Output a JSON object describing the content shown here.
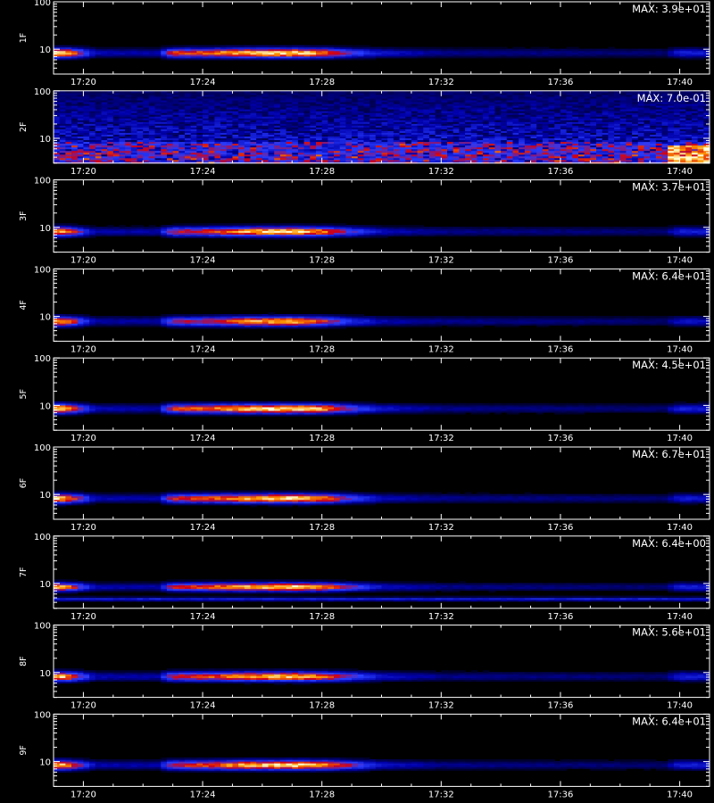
{
  "chart_data": {
    "type": "heatmap",
    "colors": {
      "background": "#000000",
      "axes": "#ffffff",
      "colormap": [
        "#000000",
        "#0000b0",
        "#2030ff",
        "#d00010",
        "#ffa000",
        "#ffffd0"
      ]
    },
    "x_ticks": [
      "17:20",
      "17:24",
      "17:28",
      "17:32",
      "17:36",
      "17:40"
    ],
    "x_range_minutes": [
      "17:19",
      "17:41"
    ],
    "y_scale": "log",
    "y_range": [
      3,
      100
    ],
    "y_ticks": [
      "100",
      "10"
    ],
    "xlabel": "",
    "panels": [
      {
        "ylabel": "1F",
        "max": "MAX: 3.9e+01",
        "band": [
          4.8,
          8.2
        ],
        "peak": 8.5,
        "activity": [
          [
            0,
            1.0
          ],
          [
            0.4,
            0.95
          ],
          [
            1.0,
            0.5
          ],
          [
            1.4,
            0.2
          ],
          [
            3.5,
            0.18
          ],
          [
            4.0,
            0.7
          ],
          [
            5.0,
            0.75
          ],
          [
            6.5,
            0.95
          ],
          [
            8.0,
            1.0
          ],
          [
            9.0,
            0.85
          ],
          [
            10.0,
            0.45
          ],
          [
            11.0,
            0.25
          ],
          [
            13.0,
            0.15
          ],
          [
            20.5,
            0.12
          ],
          [
            21.0,
            0.3
          ],
          [
            22.0,
            0.28
          ]
        ]
      },
      {
        "ylabel": "2F",
        "max": "MAX: 7.0e-01",
        "band": [
          3,
          100
        ],
        "peak": 0.7,
        "noisy": true,
        "activity": [
          [
            0,
            0.6
          ],
          [
            22.0,
            0.6
          ]
        ]
      },
      {
        "ylabel": "3F",
        "max": "MAX: 3.7e+01",
        "band": [
          4.8,
          8.2
        ],
        "peak": 8.3,
        "activity": [
          [
            0,
            0.9
          ],
          [
            0.4,
            0.85
          ],
          [
            1.0,
            0.4
          ],
          [
            1.4,
            0.18
          ],
          [
            3.5,
            0.18
          ],
          [
            4.0,
            0.6
          ],
          [
            5.0,
            0.65
          ],
          [
            6.5,
            0.9
          ],
          [
            8.0,
            1.0
          ],
          [
            9.0,
            0.8
          ],
          [
            10.0,
            0.45
          ],
          [
            11.0,
            0.22
          ],
          [
            13.0,
            0.15
          ],
          [
            20.5,
            0.12
          ],
          [
            21.0,
            0.3
          ],
          [
            22.0,
            0.28
          ]
        ]
      },
      {
        "ylabel": "4F",
        "max": "MAX: 6.4e+01",
        "band": [
          4.8,
          8.2
        ],
        "peak": 8.0,
        "activity": [
          [
            0,
            0.9
          ],
          [
            0.4,
            0.85
          ],
          [
            1.0,
            0.4
          ],
          [
            1.4,
            0.18
          ],
          [
            3.5,
            0.18
          ],
          [
            4.0,
            0.55
          ],
          [
            5.0,
            0.6
          ],
          [
            6.5,
            0.85
          ],
          [
            8.0,
            0.95
          ],
          [
            9.0,
            0.7
          ],
          [
            10.0,
            0.35
          ],
          [
            11.0,
            0.2
          ],
          [
            13.0,
            0.15
          ],
          [
            20.5,
            0.12
          ],
          [
            21.0,
            0.25
          ],
          [
            22.0,
            0.22
          ]
        ]
      },
      {
        "ylabel": "5F",
        "max": "MAX: 4.5e+01",
        "band": [
          4.8,
          8.2
        ],
        "peak": 8.7,
        "activity": [
          [
            0,
            1.0
          ],
          [
            0.4,
            0.95
          ],
          [
            1.0,
            0.45
          ],
          [
            1.4,
            0.2
          ],
          [
            3.5,
            0.18
          ],
          [
            4.0,
            0.7
          ],
          [
            5.0,
            0.75
          ],
          [
            6.5,
            0.95
          ],
          [
            8.0,
            1.0
          ],
          [
            9.0,
            0.9
          ],
          [
            10.0,
            0.5
          ],
          [
            11.0,
            0.25
          ],
          [
            13.0,
            0.15
          ],
          [
            20.5,
            0.12
          ],
          [
            21.0,
            0.3
          ],
          [
            22.0,
            0.28
          ]
        ]
      },
      {
        "ylabel": "6F",
        "max": "MAX: 6.7e+01",
        "band": [
          4.8,
          8.2
        ],
        "peak": 8.4,
        "activity": [
          [
            0,
            0.95
          ],
          [
            0.4,
            0.9
          ],
          [
            1.0,
            0.45
          ],
          [
            1.4,
            0.2
          ],
          [
            3.5,
            0.18
          ],
          [
            4.0,
            0.65
          ],
          [
            5.0,
            0.7
          ],
          [
            6.5,
            0.9
          ],
          [
            8.0,
            1.0
          ],
          [
            9.0,
            0.85
          ],
          [
            10.0,
            0.45
          ],
          [
            11.0,
            0.22
          ],
          [
            13.0,
            0.15
          ],
          [
            20.5,
            0.12
          ],
          [
            21.0,
            0.28
          ],
          [
            22.0,
            0.26
          ]
        ]
      },
      {
        "ylabel": "7F",
        "max": "MAX: 6.4e+00",
        "band": [
          6.5,
          10.5
        ],
        "peak": 8.6,
        "second_band": [
          4.4,
          5.2
        ],
        "activity": [
          [
            0,
            0.9
          ],
          [
            0.4,
            0.85
          ],
          [
            1.0,
            0.45
          ],
          [
            1.4,
            0.2
          ],
          [
            3.5,
            0.18
          ],
          [
            4.0,
            0.65
          ],
          [
            5.0,
            0.75
          ],
          [
            6.5,
            0.9
          ],
          [
            8.0,
            1.0
          ],
          [
            9.0,
            0.85
          ],
          [
            10.0,
            0.5
          ],
          [
            11.0,
            0.25
          ],
          [
            13.0,
            0.15
          ],
          [
            20.5,
            0.12
          ],
          [
            21.0,
            0.3
          ],
          [
            22.0,
            0.28
          ]
        ]
      },
      {
        "ylabel": "8F",
        "max": "MAX: 5.6e+01",
        "band": [
          4.8,
          8.2
        ],
        "peak": 8.4,
        "activity": [
          [
            0,
            0.95
          ],
          [
            0.4,
            0.9
          ],
          [
            1.0,
            0.45
          ],
          [
            1.4,
            0.2
          ],
          [
            3.5,
            0.18
          ],
          [
            4.0,
            0.65
          ],
          [
            5.0,
            0.7
          ],
          [
            6.5,
            0.85
          ],
          [
            8.0,
            0.95
          ],
          [
            9.0,
            0.8
          ],
          [
            10.0,
            0.5
          ],
          [
            11.0,
            0.25
          ],
          [
            13.0,
            0.15
          ],
          [
            20.5,
            0.12
          ],
          [
            21.0,
            0.3
          ],
          [
            22.0,
            0.28
          ]
        ]
      },
      {
        "ylabel": "9F",
        "max": "MAX: 6.4e+01",
        "band": [
          4.8,
          8.2
        ],
        "peak": 8.6,
        "activity": [
          [
            0,
            0.95
          ],
          [
            0.4,
            0.9
          ],
          [
            1.0,
            0.45
          ],
          [
            1.4,
            0.2
          ],
          [
            3.5,
            0.18
          ],
          [
            4.0,
            0.65
          ],
          [
            5.0,
            0.7
          ],
          [
            6.5,
            0.9
          ],
          [
            8.0,
            1.0
          ],
          [
            9.0,
            0.9
          ],
          [
            10.0,
            0.55
          ],
          [
            11.0,
            0.25
          ],
          [
            13.0,
            0.15
          ],
          [
            20.5,
            0.12
          ],
          [
            21.0,
            0.3
          ],
          [
            22.0,
            0.28
          ]
        ]
      }
    ]
  }
}
